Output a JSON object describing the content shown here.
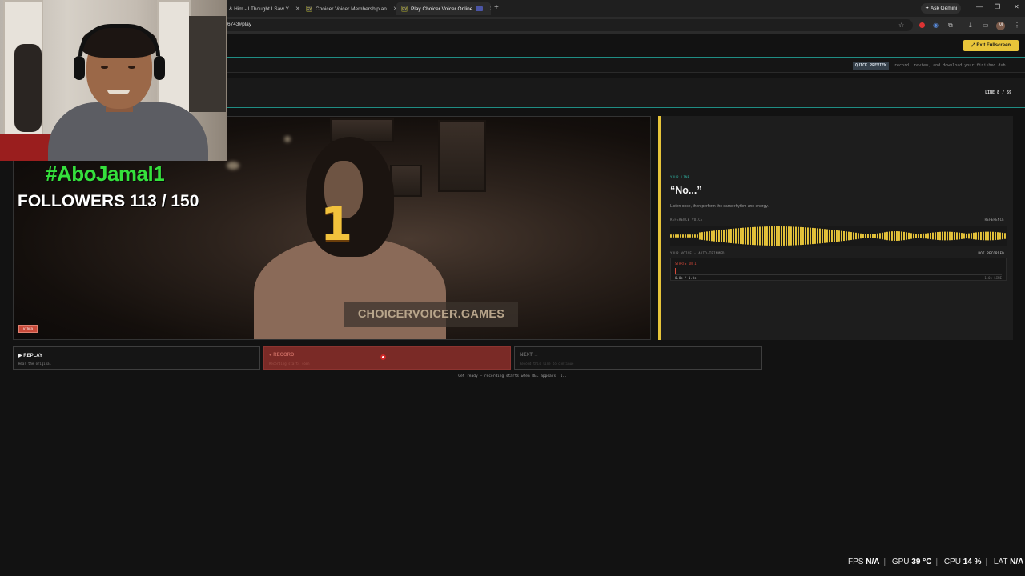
{
  "browser": {
    "tabs": [
      {
        "label": "& Him - I Thought I Saw Y",
        "favicon": ""
      },
      {
        "label": "Choicer Voicer Membership an",
        "favicon": "CV"
      },
      {
        "label": "Play Choicer Voicer Online",
        "favicon": "CV"
      }
    ],
    "new_tab": "+",
    "ask_gemini": "Ask Gemini",
    "url": "6743#play",
    "profile_initial": "M",
    "icons": [
      "star-icon",
      "record-icon",
      "extension-icon",
      "puzzle-icon",
      "download-icon",
      "sidebar-icon",
      "menu-icon"
    ]
  },
  "app": {
    "exit_fullscreen": "Exit Fullscreen",
    "quick_preview_tag": "QUICK PREVIEW",
    "quick_preview_text": "record, review, and download your finished dub",
    "line_counter": "LINE 8 / 59"
  },
  "video": {
    "countdown": "1",
    "watermark": "CHOICERVOICER.GAMES",
    "badge": "VIDEO"
  },
  "panel": {
    "eyebrow": "YOUR LINE",
    "line": "“No...”",
    "instruction": "Listen once, then perform the same rhythm and energy.",
    "reference_label": "REFERENCE VOICE",
    "reference_tag": "REFERENCE",
    "user_label": "YOUR VOICE - AUTO-TRIMMED",
    "user_status": "NOT RECORDED",
    "starts_in": "STARTS IN 1",
    "time_left": "0.0s / 1.0s",
    "time_right": "1.0s LINE",
    "accent": "#e6c43a"
  },
  "actions": {
    "replay_label": "▶ REPLAY",
    "replay_sub": "Hear the original",
    "record_label": "● RECORD",
    "record_sub": "Recording starts soon",
    "next_label": "NEXT →",
    "next_sub": "Record this line to continue",
    "status": "Get ready — recording starts when REC appears. 1.."
  },
  "overlay": {
    "hashtag": "#AboJamal1",
    "followers": "FOLLOWERS 113 / 150"
  },
  "perf": {
    "fps_label": "FPS",
    "fps_value": "N/A",
    "gpu_label": "GPU",
    "gpu_value": "39 °C",
    "cpu_label": "CPU",
    "cpu_value": "14 %",
    "lat_label": "LAT",
    "lat_value": "N/A"
  }
}
